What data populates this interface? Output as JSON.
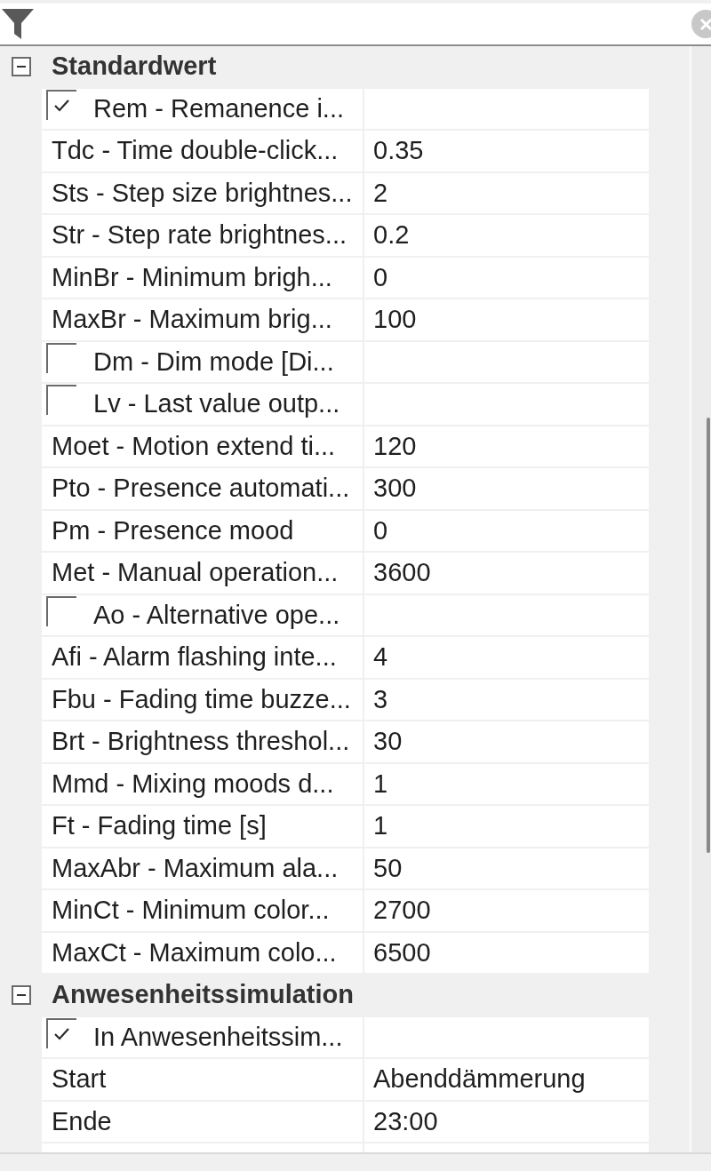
{
  "groups": [
    {
      "title": "Standardwert",
      "expanded": true,
      "properties": [
        {
          "kind": "checkbox",
          "name": "Rem - Remanence i...",
          "checked": true
        },
        {
          "kind": "text",
          "name": "Tdc - Time double-click...",
          "value": "0.35"
        },
        {
          "kind": "text",
          "name": "Sts - Step size brightnes...",
          "value": "2"
        },
        {
          "kind": "text",
          "name": "Str - Step rate brightnes...",
          "value": "0.2"
        },
        {
          "kind": "text",
          "name": "MinBr - Minimum brigh...",
          "value": "0"
        },
        {
          "kind": "text",
          "name": "MaxBr - Maximum brig...",
          "value": "100"
        },
        {
          "kind": "checkbox",
          "name": "Dm - Dim mode [Di...",
          "checked": false
        },
        {
          "kind": "checkbox",
          "name": "Lv - Last value outp...",
          "checked": false
        },
        {
          "kind": "text",
          "name": "Moet - Motion extend ti...",
          "value": "120"
        },
        {
          "kind": "text",
          "name": "Pto - Presence automati...",
          "value": "300"
        },
        {
          "kind": "text",
          "name": "Pm - Presence mood",
          "value": "0"
        },
        {
          "kind": "text",
          "name": "Met - Manual operation...",
          "value": "3600"
        },
        {
          "kind": "checkbox",
          "name": "Ao - Alternative ope...",
          "checked": false
        },
        {
          "kind": "text",
          "name": "Afi - Alarm flashing inte...",
          "value": "4"
        },
        {
          "kind": "text",
          "name": "Fbu - Fading time buzze...",
          "value": "3"
        },
        {
          "kind": "text",
          "name": "Brt - Brightness threshol...",
          "value": "30"
        },
        {
          "kind": "text",
          "name": "Mmd - Mixing moods d...",
          "value": "1"
        },
        {
          "kind": "text",
          "name": "Ft - Fading time [s]",
          "value": "1"
        },
        {
          "kind": "text",
          "name": "MaxAbr - Maximum ala...",
          "value": "50"
        },
        {
          "kind": "text",
          "name": "MinCt - Minimum color...",
          "value": "2700"
        },
        {
          "kind": "text",
          "name": "MaxCt - Maximum colo...",
          "value": "6500"
        }
      ]
    },
    {
      "title": "Anwesenheitssimulation",
      "expanded": true,
      "properties": [
        {
          "kind": "checkbox",
          "name": "In Anwesenheitssim...",
          "checked": true
        },
        {
          "kind": "text",
          "name": "Start",
          "value": "Abenddämmerung"
        },
        {
          "kind": "text",
          "name": "Ende",
          "value": "23:00"
        }
      ]
    }
  ]
}
